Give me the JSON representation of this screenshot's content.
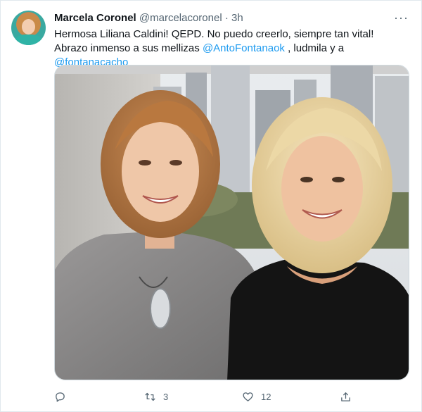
{
  "tweet": {
    "author_name": "Marcela Coronel",
    "author_handle": "@marcelacoronel",
    "separator": "·",
    "time": "3h",
    "more_label": "···",
    "text_part1": "Hermosa Liliana Caldini! QEPD. No puedo creerlo, siempre tan vital! Abrazo inmenso a sus mellizas ",
    "mention1": "@AntoFontanaok",
    "text_part2": " , ludmila y a ",
    "mention2": "@fontanacacho",
    "media_icon": "photo-two-women-city-background",
    "actions": {
      "reply_icon": "reply-icon",
      "reply_count": "",
      "retweet_icon": "retweet-icon",
      "retweet_count": "3",
      "like_icon": "like-icon",
      "like_count": "12",
      "share_icon": "share-icon"
    },
    "colors": {
      "accent": "#1d9bf0",
      "text": "#0f1419",
      "muted": "#536471"
    }
  }
}
